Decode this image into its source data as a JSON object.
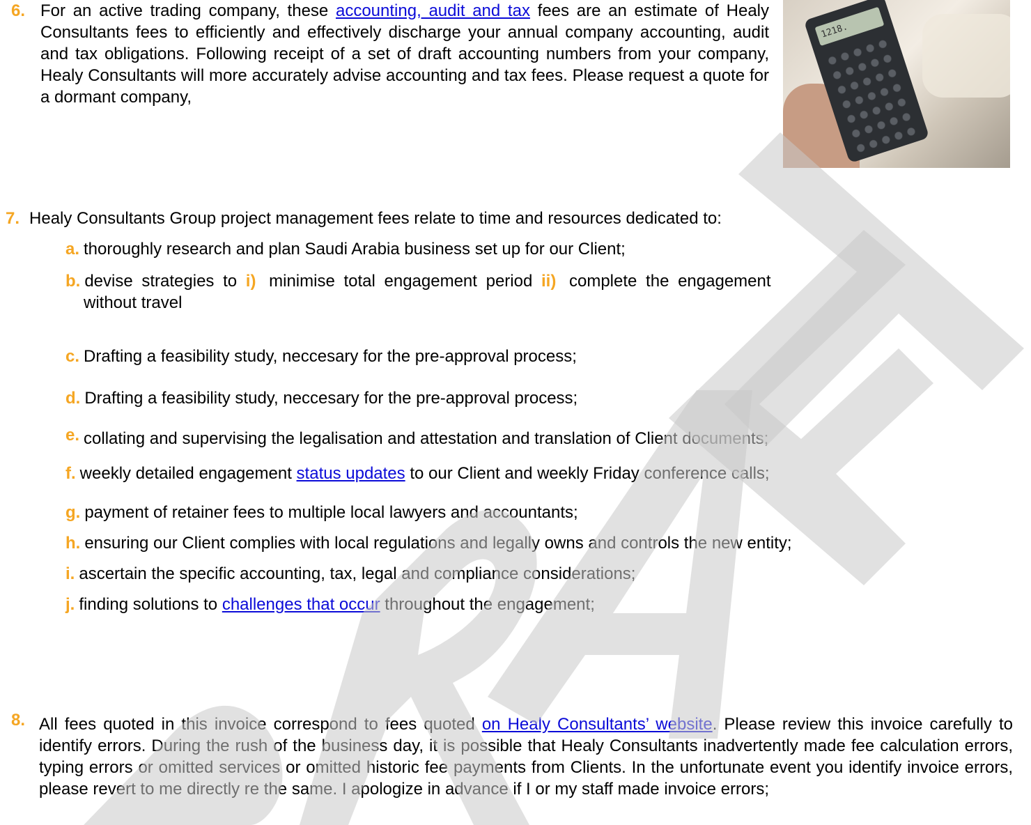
{
  "colors": {
    "number": "#f5a623",
    "link": "#0b0bd8",
    "watermark": "#c8c8c8"
  },
  "watermark_icon": "draft-watermark",
  "p6": {
    "num": "6.",
    "before_link": "For an active trading company, these ",
    "link": "accounting, audit and tax",
    "after_link": " fees are an estimate of Healy Consultants fees to efficiently and effectively discharge your annual company accounting, audit and tax obligations. Following receipt of a set of draft accounting numbers from your company, Healy Consultants will more accurately advise accounting and tax fees. Please request a quote for a dormant company,",
    "image_icon": "calculator-photo",
    "calc_display": "1218."
  },
  "p7": {
    "num": "7.",
    "lead": "Healy Consultants Group project management fees relate to time and resources dedicated to:",
    "a": {
      "num": "a.",
      "text": "thoroughly research and plan Saudi Arabia business set up for our Client;"
    },
    "b": {
      "num": "b.",
      "t1": "devise strategies to ",
      "i_num": "i)",
      "t2": " minimise total engagement period ",
      "ii_num": "ii)",
      "t3": " complete the engagement",
      "t4": "without travel"
    },
    "c": {
      "num": "c.",
      "text": "Drafting a feasibility study, neccesary for the pre-approval process;"
    },
    "d": {
      "num": "d.",
      "text": "Drafting a feasibility study, neccesary for the pre-approval process;"
    },
    "e": {
      "num": "e.",
      "text": "collating and supervising the legalisation and attestation and translation of Client documents;"
    },
    "f": {
      "num": "f.",
      "before": "weekly detailed engagement ",
      "link": "status updates",
      "after": " to our Client and weekly Friday conference calls;"
    },
    "g": {
      "num": "g.",
      "text": "payment of retainer fees to multiple local lawyers and accountants;"
    },
    "h": {
      "num": "h.",
      "text": "ensuring our Client complies with local regulations and legally owns and controls the new entity;"
    },
    "i": {
      "num": "i.",
      "text": "ascertain the specific accounting, tax, legal and compliance considerations;"
    },
    "j": {
      "num": "j.",
      "before": "finding solutions to ",
      "link": "challenges that occur",
      "after": " throughout the engagement;"
    }
  },
  "p8": {
    "num": "8.",
    "before_link": "All fees quoted in this invoice correspond to fees quoted ",
    "link": "on Healy Consultants’ website",
    "after_link": ". Please review this invoice carefully to identify errors. During the rush of the business day, it is possible that Healy Consultants inadvertently made fee calculation errors, typing errors or omitted services or omitted historic fee payments from Clients. In the unfortunate event you identify invoice errors, please revert to me directly re the same. I apologize in advance if I or my staff made invoice errors;"
  }
}
